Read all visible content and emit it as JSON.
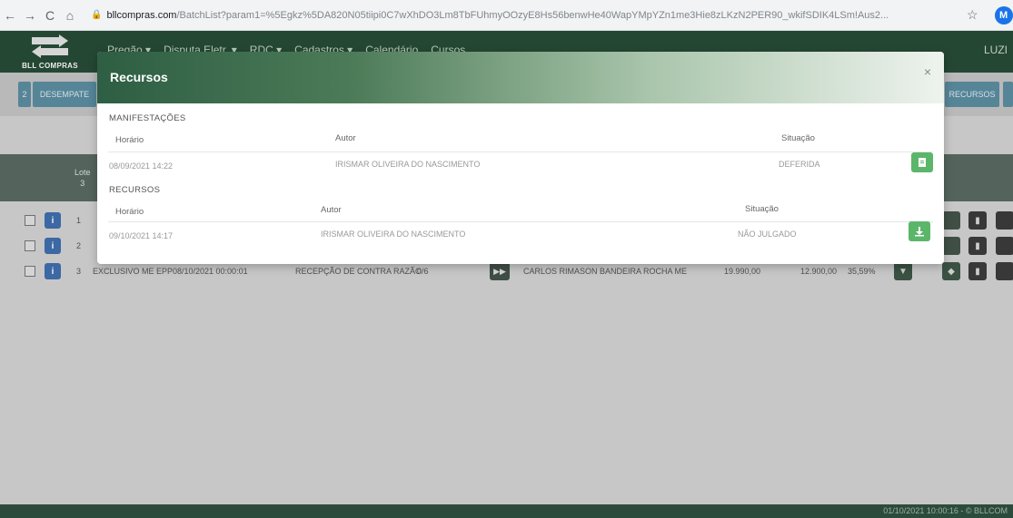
{
  "browser": {
    "back": "←",
    "forward": "→",
    "reload": "C",
    "home": "⌂",
    "url_domain": "bllcompras.com",
    "url_path": "/BatchList?param1=%5Egkz%5DA820N05tiipi0C7wXhDO3Lm8TbFUhmyOOzyE8Hs56benwHe40WapYMpYZn1me3Hie8zLKzN2PER90_wkifSDIK4LSm!Aus2...",
    "star": "☆",
    "profile_initial": "M"
  },
  "header": {
    "logo_text": "BLL COMPRAS",
    "menu": [
      "Pregão ▾",
      "Disputa Eletr. ▾",
      "RDC ▾",
      "Cadastros ▾",
      "Calendário",
      "Cursos"
    ],
    "user": "LUZI"
  },
  "background": {
    "toolbar_left": "2",
    "toolbar_desempate": "DESEMPATE",
    "toolbar_recursos": "RECURSOS",
    "lote_label": "Lote",
    "lote_count": "3",
    "rows": [
      {
        "num": "1"
      },
      {
        "num": "2"
      },
      {
        "num": "3",
        "type": "EXCLUSIVO ME EPP",
        "date": "08/10/2021 00:00:01",
        "phase": "RECEPÇÃO DE CONTRA RAZÃO",
        "ratio": "0/6",
        "company": "CARLOS RIMASON BANDEIRA ROCHA ME",
        "value1": "19.990,00",
        "value2": "12.900,00",
        "pct": "35,59%"
      }
    ]
  },
  "footer": {
    "text": "01/10/2021 10:00:16 - © BLLCOM"
  },
  "modal": {
    "title": "Recursos",
    "close": "×",
    "manifestacoes": {
      "label": "MANIFESTAÇÕES",
      "headers": {
        "horario": "Horário",
        "autor": "Autor",
        "situacao": "Situação"
      },
      "row": {
        "horario": "08/09/2021 14:22",
        "autor": "IRISMAR OLIVEIRA DO NASCIMENTO",
        "situacao": "DEFERIDA",
        "action_icon": "document-icon"
      }
    },
    "recursos": {
      "label": "RECURSOS",
      "headers": {
        "horario": "Horário",
        "autor": "Autor",
        "situacao": "Situação"
      },
      "row": {
        "horario": "09/10/2021 14:17",
        "autor": "IRISMAR OLIVEIRA DO NASCIMENTO",
        "situacao": "NÃO JULGADO",
        "action_icon": "download-icon"
      }
    }
  }
}
